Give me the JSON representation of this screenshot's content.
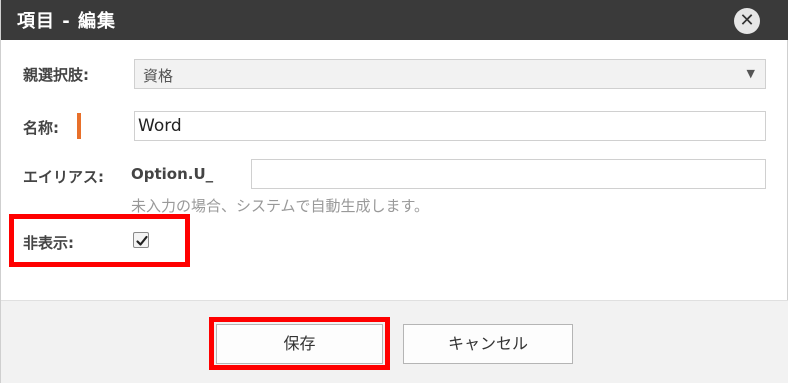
{
  "dialog": {
    "title": "項目 - 編集",
    "close_icon": "close-icon"
  },
  "form": {
    "parent_label": "親選択肢:",
    "parent_value": "資格",
    "name_label": "名称:",
    "name_value": "Word",
    "alias_label": "エイリアス:",
    "alias_prefix": "Option.U_",
    "alias_value": "",
    "alias_hint": "未入力の場合、システムで自動生成します。",
    "hidden_label": "非表示:",
    "hidden_checked": true
  },
  "buttons": {
    "save_label": "保存",
    "cancel_label": "キャンセル"
  },
  "colors": {
    "titlebar": "#3a3a3a",
    "required_marker": "#e8702a",
    "highlight": "#ff0000"
  }
}
